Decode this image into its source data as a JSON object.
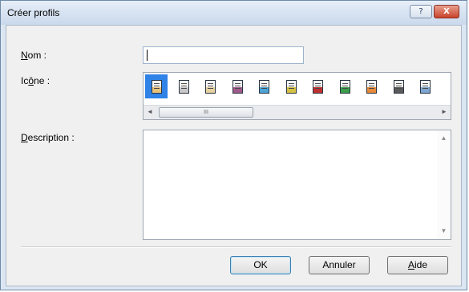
{
  "window": {
    "title": "Créer profils",
    "help_glyph": "?",
    "close_glyph": "X"
  },
  "form": {
    "name_label_access": "N",
    "name_label_rest": "om :",
    "name_value": "",
    "icon_label_first": "Ic",
    "icon_label_access": "ô",
    "icon_label_rest": "ne :",
    "description_label_access": "D",
    "description_label_rest": "escription :",
    "description_value": ""
  },
  "icons": {
    "selected_index": 0,
    "items": [
      {
        "name": "profile-icon-1",
        "color": "#e9c27a"
      },
      {
        "name": "profile-icon-2",
        "color": "#c8c8c8"
      },
      {
        "name": "profile-icon-3",
        "color": "#e6d2a0"
      },
      {
        "name": "profile-icon-4",
        "color": "#a05a8c"
      },
      {
        "name": "profile-icon-5",
        "color": "#4ba3d6"
      },
      {
        "name": "profile-icon-6",
        "color": "#d6c243"
      },
      {
        "name": "profile-icon-7",
        "color": "#c03030"
      },
      {
        "name": "profile-icon-8",
        "color": "#3b9e4a"
      },
      {
        "name": "profile-icon-9",
        "color": "#e78a3a"
      },
      {
        "name": "profile-icon-10",
        "color": "#5a5a5a"
      },
      {
        "name": "profile-icon-11",
        "color": "#7ea6d0"
      }
    ],
    "scroll_left": "◄",
    "scroll_right": "►",
    "thumb_grip": "III"
  },
  "description_scroll": {
    "up": "▲",
    "down": "▼"
  },
  "buttons": {
    "ok": "OK",
    "cancel": "Annuler",
    "help_access": "A",
    "help_rest": "ide"
  }
}
